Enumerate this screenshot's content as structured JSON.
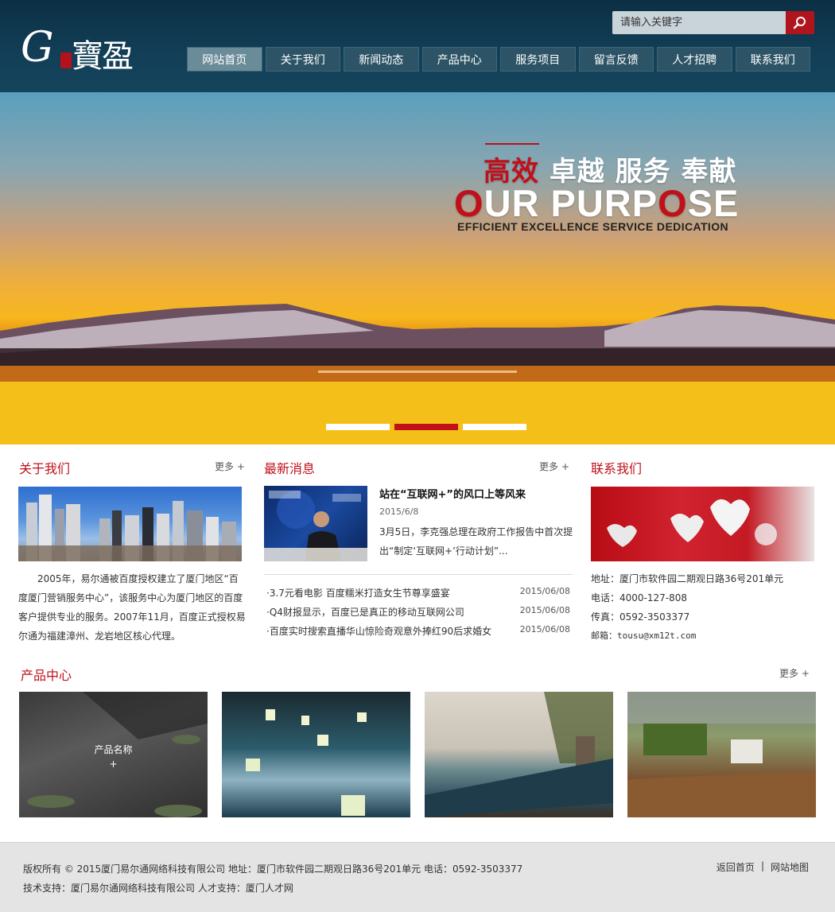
{
  "header": {
    "logo": {
      "letter": "G",
      "chars": "寶盈"
    },
    "search": {
      "placeholder": "请输入关键字"
    },
    "nav": [
      {
        "label": "网站首页",
        "active": true
      },
      {
        "label": "关于我们"
      },
      {
        "label": "新闻动态"
      },
      {
        "label": "产品中心"
      },
      {
        "label": "服务项目"
      },
      {
        "label": "留言反馈"
      },
      {
        "label": "人才招聘"
      },
      {
        "label": "联系我们"
      }
    ]
  },
  "banner": {
    "cn_red": "高效",
    "cn_rest": " 卓越 服务 奉献",
    "en_big": {
      "p1": "O",
      "p2": "UR PURP",
      "p3": "O",
      "p4": "SE"
    },
    "en_small": "EFFICIENT EXCELLENCE SERVICE DEDICATION",
    "slides": 3,
    "active_slide": 2
  },
  "about": {
    "title": "关于我们",
    "more": "更多 +",
    "text": "　　2005年，易尔通被百度授权建立了厦门地区“百度厦门营销服务中心”，该服务中心为厦门地区的百度客户提供专业的服务。2007年11月，百度正式授权易尔通为福建漳州、龙岩地区核心代理。"
  },
  "news": {
    "title": "最新消息",
    "more": "更多 +",
    "featured": {
      "headline": "站在“互联网+”的风口上等风来",
      "date": "2015/6/8",
      "summary": "3月5日，李克强总理在政府工作报告中首次提出“制定‘互联网+’行动计划”..."
    },
    "list": [
      {
        "title": "·3.7元看电影 百度糯米打造女生节尊享盛宴",
        "date": "2015/06/08"
      },
      {
        "title": "·Q4财报显示，百度已是真正的移动互联网公司",
        "date": "2015/06/08"
      },
      {
        "title": "·百度实时搜索直播华山惊险奇观意外捧红90后求婚女",
        "date": "2015/06/08"
      }
    ]
  },
  "contact": {
    "title": "联系我们",
    "address": "地址：厦门市软件园二期观日路36号201单元",
    "phone": "电话：4000-127-808",
    "fax": "传真：0592-3503377",
    "email": "邮箱：tousu@xm12t.com"
  },
  "products": {
    "title": "产品中心",
    "more": "更多 +",
    "hover_name": "产品名称",
    "hover_plus": "+"
  },
  "footer": {
    "line1": "版权所有 © 2015厦门易尔通网络科技有限公司 地址：厦门市软件园二期观日路36号201单元 电话：0592-3503377",
    "line2": "技术支持：厦门易尔通网络科技有限公司 人才支持：厦门人才网",
    "link_home": "返回首页",
    "link_sep": "|",
    "link_sitemap": "网站地图"
  }
}
